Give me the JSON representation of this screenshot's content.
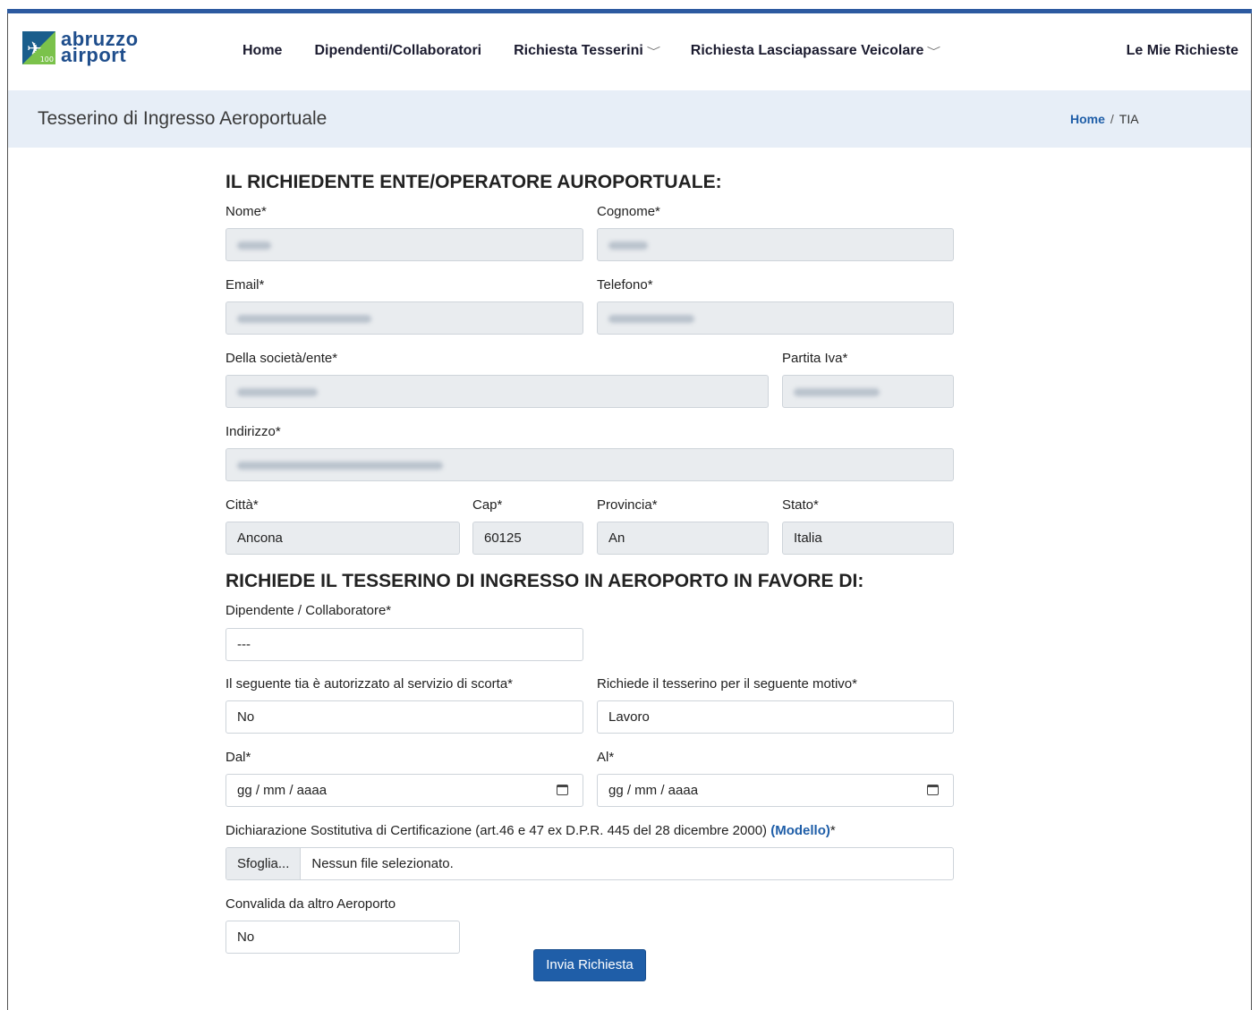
{
  "brand": {
    "logo_line1": "abruzzo",
    "logo_line2": "airport",
    "logo_badge": "100",
    "colors": {
      "primary": "#1f5ea8",
      "topbar": "#2d5aa0",
      "logo_green": "#7bc24b",
      "title_bg": "#e7eef7"
    }
  },
  "nav": {
    "items": [
      {
        "label": "Home",
        "dropdown": false
      },
      {
        "label": "Dipendenti/Collaboratori",
        "dropdown": false
      },
      {
        "label": "Richiesta Tesserini",
        "dropdown": true
      },
      {
        "label": "Richiesta Lasciapassare Veicolare",
        "dropdown": true
      }
    ],
    "right_label": "Le Mie Richieste",
    "dropdown_icon": "chevron-down-icon"
  },
  "header": {
    "title": "Tesserino di Ingresso Aeroportuale",
    "breadcrumb": {
      "home": "Home",
      "separator": "/",
      "current": "TIA"
    }
  },
  "form": {
    "section1_title": "IL RICHIEDENTE ENTE/OPERATORE AUROPORTUALE:",
    "nome": {
      "label": "Nome*",
      "value": ""
    },
    "cognome": {
      "label": "Cognome*",
      "value": ""
    },
    "email": {
      "label": "Email*",
      "value": ""
    },
    "telefono": {
      "label": "Telefono*",
      "value": ""
    },
    "societa": {
      "label": "Della società/ente*",
      "value": ""
    },
    "partita_iva": {
      "label": "Partita Iva*",
      "value": ""
    },
    "indirizzo": {
      "label": "Indirizzo*",
      "value": ""
    },
    "citta": {
      "label": "Città*",
      "value": "Ancona"
    },
    "cap": {
      "label": "Cap*",
      "value": "60125"
    },
    "provincia": {
      "label": "Provincia*",
      "value": "An"
    },
    "stato": {
      "label": "Stato*",
      "value": "Italia"
    },
    "section2_title": "RICHIEDE IL TESSERINO DI INGRESSO IN AEROPORTO IN FAVORE DI:",
    "dipendente": {
      "label": "Dipendente / Collaboratore*",
      "value": "---"
    },
    "scorta": {
      "label": "Il seguente tia è autorizzato al servizio di scorta*",
      "value": "No"
    },
    "motivo": {
      "label": "Richiede il tesserino per il seguente motivo*",
      "value": "Lavoro"
    },
    "dal": {
      "label": "Dal*",
      "placeholder": "gg / mm / aaaa"
    },
    "al": {
      "label": "Al*",
      "placeholder": "gg / mm / aaaa"
    },
    "dichiarazione": {
      "label": "Dichiarazione Sostitutiva di Certificazione (art.46 e 47 ex D.P.R. 445 del 28 dicembre 2000)",
      "link": "(Modello)",
      "required": "*",
      "button": "Sfoglia...",
      "status": "Nessun file selezionato."
    },
    "convalida": {
      "label": "Convalida da altro Aeroporto",
      "value": "No"
    },
    "submit_label": "Invia Richiesta"
  }
}
